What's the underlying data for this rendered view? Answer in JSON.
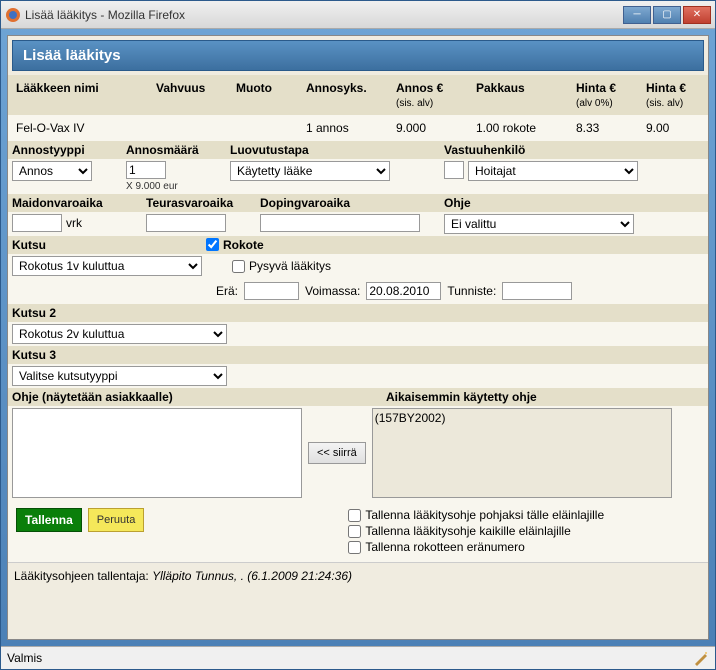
{
  "window": {
    "title": "Lisää lääkitys - Mozilla Firefox"
  },
  "header": {
    "title": "Lisää lääkitys"
  },
  "table": {
    "headers": {
      "name": "Lääkkeen nimi",
      "vahvuus": "Vahvuus",
      "muoto": "Muoto",
      "annosyks": "Annosyks.",
      "annose": "Annos €",
      "annose_sub": "(sis. alv)",
      "pakkaus": "Pakkaus",
      "hinta0": "Hinta €",
      "hinta0_sub": "(alv 0%)",
      "hintaalv": "Hinta €",
      "hintaalv_sub": "(sis. alv)"
    },
    "row": {
      "name": "Fel-O-Vax IV",
      "vahvuus": "",
      "muoto": "",
      "annosyks": "1 annos",
      "annose": "9.000",
      "pakkaus": "1.00 rokote",
      "hinta0": "8.33",
      "hintaalv": "9.00"
    }
  },
  "labels": {
    "annostyyppi": "Annostyyppi",
    "annosmaara": "Annosmäärä",
    "luovutustapa": "Luovutustapa",
    "vastuuhenkilo": "Vastuuhenkilö",
    "maidonvaroaika": "Maidonvaroaika",
    "teurasvaroaika": "Teurasvaroaika",
    "dopingvaroaika": "Dopingvaroaika",
    "ohje": "Ohje",
    "vrk": "vrk",
    "kutsu": "Kutsu",
    "rokote": "Rokote",
    "pysyva": "Pysyvä lääkitys",
    "era": "Erä:",
    "voimassa": "Voimassa:",
    "tunniste": "Tunniste:",
    "kutsu2": "Kutsu 2",
    "kutsu3": "Kutsu 3",
    "ohje_asiakas": "Ohje (näytetään asiakkaalle)",
    "aikaisemmin": "Aikaisemmin käytetty ohje",
    "siirra": "<< siirrä",
    "tallenna": "Tallenna",
    "peruuta": "Peruuta",
    "save_opt1": "Tallenna lääkitysohje pohjaksi tälle eläinlajille",
    "save_opt2": "Tallenna lääkitysohje kaikille eläinlajille",
    "save_opt3": "Tallenna rokotteen eränumero"
  },
  "values": {
    "annostyyppi": "Annos",
    "annosmaara": "1",
    "annosmaara_note": "X 9.000 eur",
    "luovutustapa": "Käytetty lääke",
    "vastuu_prefix": "",
    "vastuuhenkilo": "Hoitajat",
    "maidon": "",
    "teuras": "",
    "doping": "",
    "ohje_sel": "Ei valittu",
    "kutsu_checked": true,
    "kutsu1": "Rokotus 1v kuluttua",
    "pysyva_checked": false,
    "era": "",
    "voimassa": "20.08.2010",
    "tunniste": "",
    "kutsu2": "Rokotus 2v kuluttua",
    "kutsu3": "Valitse kutsutyyppi",
    "ohje_text": "",
    "aikaisemmin_text": "(157BY2002)",
    "opt1": false,
    "opt2": false,
    "opt3": false
  },
  "footer": {
    "tallentaja_label": "Lääkitysohjeen tallentaja: ",
    "tallentaja_value": "Ylläpito Tunnus, . (6.1.2009 21:24:36)"
  },
  "status": {
    "text": "Valmis"
  }
}
